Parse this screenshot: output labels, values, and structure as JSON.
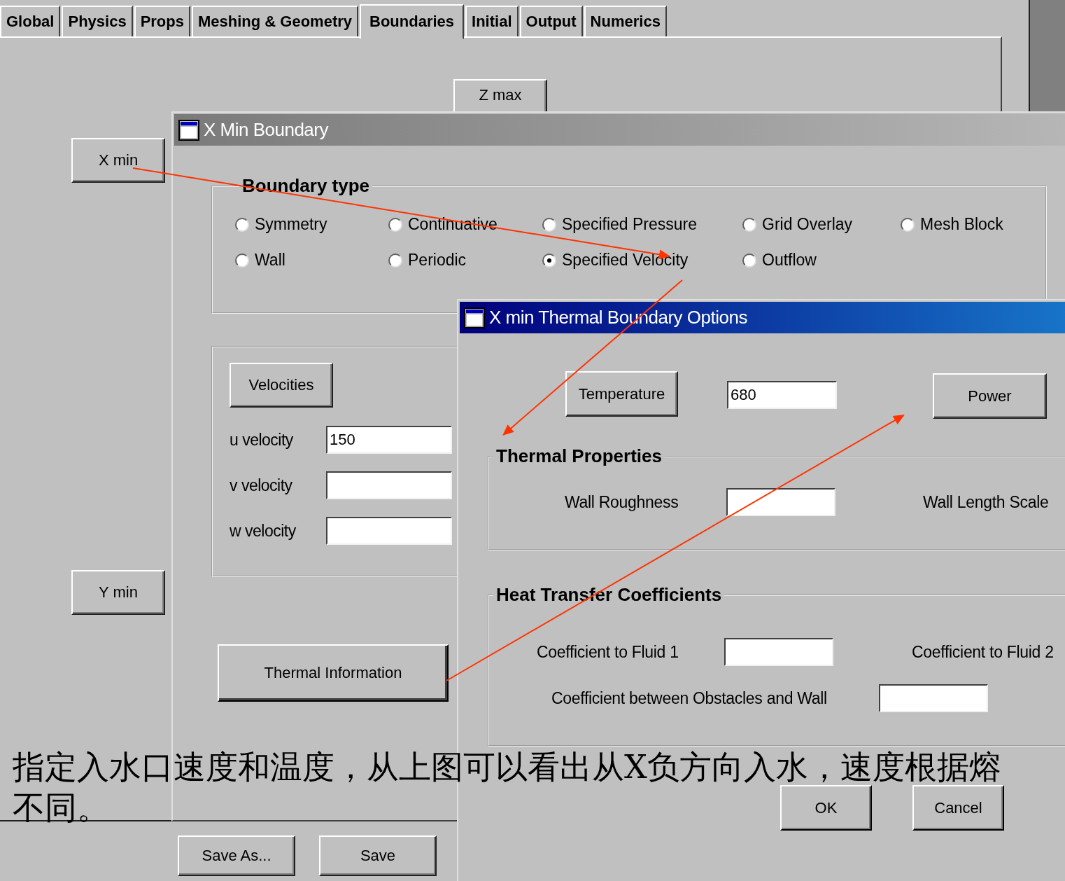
{
  "tabs": [
    {
      "label": "Global",
      "selected": false
    },
    {
      "label": "Physics",
      "selected": false
    },
    {
      "label": "Props",
      "selected": false
    },
    {
      "label": "Meshing & Geometry",
      "selected": false
    },
    {
      "label": "Boundaries",
      "selected": true
    },
    {
      "label": "Initial",
      "selected": false
    },
    {
      "label": "Output",
      "selected": false
    },
    {
      "label": "Numerics",
      "selected": false
    }
  ],
  "boundary_buttons": {
    "z_max": "Z max",
    "x_min": "X min",
    "y_min": "Y min"
  },
  "save_buttons": [
    "Save As...",
    "Save"
  ],
  "boundary_dialog": {
    "title": "X Min Boundary",
    "active": false,
    "boundary_type": {
      "title": "Boundary type",
      "options": [
        {
          "label": "Symmetry",
          "selected": false
        },
        {
          "label": "Continuative",
          "selected": false
        },
        {
          "label": "Specified Pressure",
          "selected": false
        },
        {
          "label": "Grid Overlay",
          "selected": false
        },
        {
          "label": "Mesh Block",
          "selected": false
        },
        {
          "label": "Wall",
          "selected": false
        },
        {
          "label": "Periodic",
          "selected": false
        },
        {
          "label": "Specified Velocity",
          "selected": true
        },
        {
          "label": "Outflow",
          "selected": false
        }
      ]
    },
    "velocities_button": "Velocities",
    "velocity_fields": [
      {
        "label": "u velocity",
        "value": "150"
      },
      {
        "label": "v velocity"
      },
      {
        "label": "w velocity"
      }
    ],
    "thermal_button": "Thermal Information"
  },
  "thermal_dialog": {
    "title": "X min Thermal Boundary Options",
    "active": true,
    "temperature_button": "Temperature",
    "temperature_value": "680",
    "power_button": "Power",
    "thermal_properties": {
      "title": "Thermal Properties",
      "wall_roughness": "Wall Roughness",
      "wall_length_scale": "Wall Length Scale"
    },
    "heat_transfer": {
      "title": "Heat Transfer Coefficients",
      "fluid_1": "Coefficient to Fluid 1",
      "fluid_2": "Coefficient to Fluid 2",
      "obstacles_wall": "Coefficient between Obstacles and Wall"
    },
    "buttons": [
      "OK",
      "Cancel"
    ]
  },
  "caption": [
    "指定入水口速度和温度，从上图可以看出从X负方向入水，速度根据熔",
    "不同。"
  ]
}
